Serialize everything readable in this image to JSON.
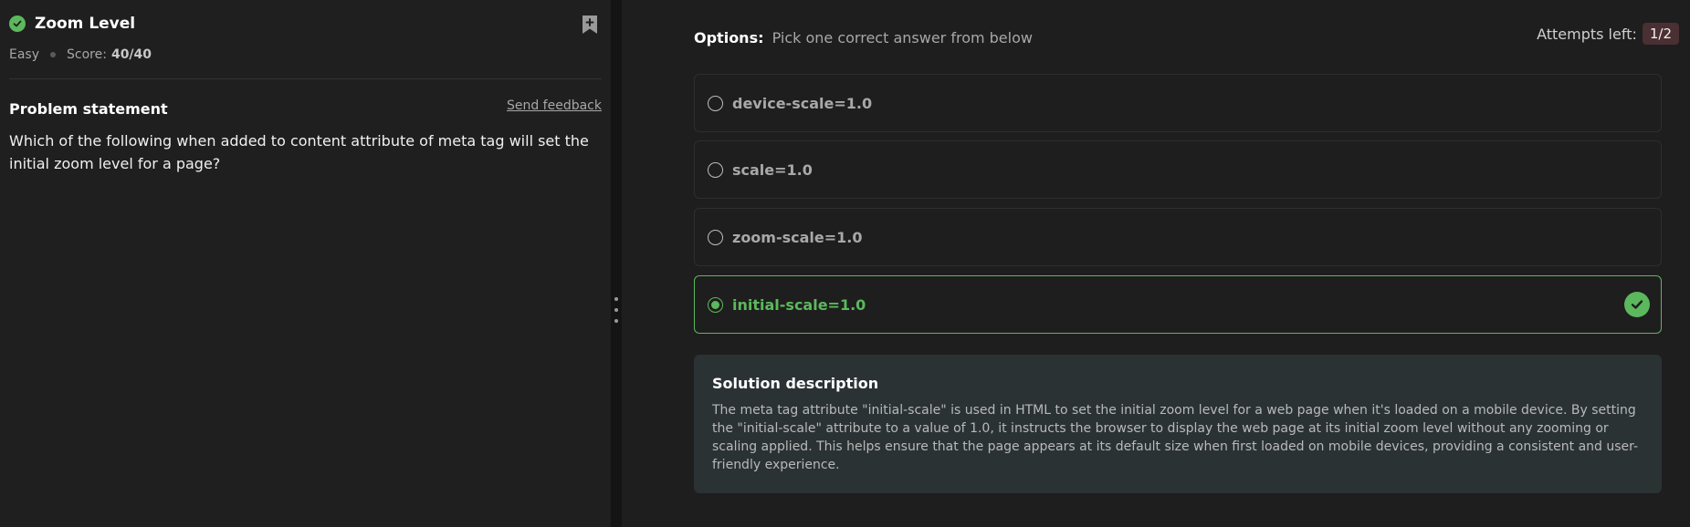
{
  "problem": {
    "title": "Zoom Level",
    "difficulty": "Easy",
    "score_label": "Score:",
    "score_value": "40/40",
    "statement_heading": "Problem statement",
    "feedback_link": "Send feedback",
    "question": "Which of the following when added to content attribute of meta tag will set the initial zoom level for a page?"
  },
  "options": {
    "label": "Options:",
    "hint": "Pick one correct answer from below",
    "attempts_label": "Attempts left:",
    "attempts_value": "1/2",
    "items": [
      {
        "label": "device-scale=1.0",
        "selected": false,
        "correct": false
      },
      {
        "label": "scale=1.0",
        "selected": false,
        "correct": false
      },
      {
        "label": "zoom-scale=1.0",
        "selected": false,
        "correct": false
      },
      {
        "label": "initial-scale=1.0",
        "selected": true,
        "correct": true
      }
    ]
  },
  "solution": {
    "title": "Solution description",
    "text": "The meta tag attribute \"initial-scale\" is used in HTML to set the initial zoom level for a web page when it's loaded on a mobile device. By setting the \"initial-scale\" attribute to a value of 1.0, it instructs the browser to display the web page at its initial zoom level without any zooming or scaling applied. This helps ensure that the page appears at its default size when first loaded on mobile devices, providing a consistent and user-friendly experience."
  },
  "colors": {
    "success": "#5cb85c",
    "attempts_badge": "#4a2f33",
    "solution_bg": "#2b3234"
  },
  "icons": {
    "status": "check-circle-icon",
    "bookmark": "bookmark-add-icon",
    "correct": "check-circle-icon",
    "resize": "drag-handle-icon"
  }
}
